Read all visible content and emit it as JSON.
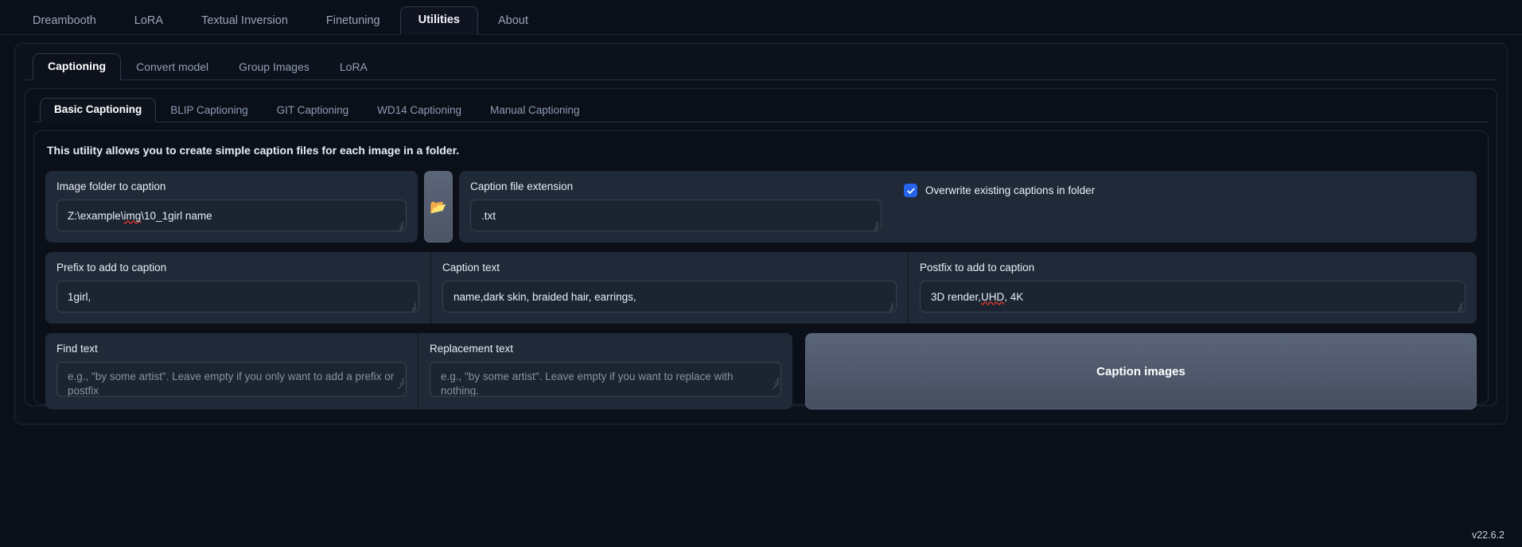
{
  "top_tabs": [
    {
      "label": "Dreambooth",
      "active": false
    },
    {
      "label": "LoRA",
      "active": false
    },
    {
      "label": "Textual Inversion",
      "active": false
    },
    {
      "label": "Finetuning",
      "active": false
    },
    {
      "label": "Utilities",
      "active": true
    },
    {
      "label": "About",
      "active": false
    }
  ],
  "second_tabs": [
    {
      "label": "Captioning",
      "active": true
    },
    {
      "label": "Convert model",
      "active": false
    },
    {
      "label": "Group Images",
      "active": false
    },
    {
      "label": "LoRA",
      "active": false
    }
  ],
  "third_tabs": [
    {
      "label": "Basic Captioning",
      "active": true
    },
    {
      "label": "BLIP Captioning",
      "active": false
    },
    {
      "label": "GIT Captioning",
      "active": false
    },
    {
      "label": "WD14 Captioning",
      "active": false
    },
    {
      "label": "Manual Captioning",
      "active": false
    }
  ],
  "description": "This utility allows you to create simple caption files for each image in a folder.",
  "fields": {
    "image_folder": {
      "label": "Image folder to caption",
      "value_prefix": "Z:\\example\\",
      "value_spell": "img",
      "value_suffix": "\\10_1girl name"
    },
    "folder_button": {
      "icon": "folder-open-icon",
      "glyph": "📂"
    },
    "caption_extension": {
      "label": "Caption file extension",
      "value": ".txt"
    },
    "overwrite": {
      "label": "Overwrite existing captions in folder",
      "checked": true,
      "color": "#2563eb"
    },
    "prefix": {
      "label": "Prefix to add to caption",
      "value": "1girl,"
    },
    "caption_text": {
      "label": "Caption text",
      "value": "name,dark skin, braided hair, earrings,"
    },
    "postfix": {
      "label": "Postfix to add to caption",
      "value_prefix": "3D render, ",
      "value_spell": "UHD",
      "value_suffix": ", 4K"
    },
    "find_text": {
      "label": "Find text",
      "value": "",
      "placeholder": "e.g., \"by some artist\". Leave empty if you only want to add a prefix or postfix"
    },
    "replacement_text": {
      "label": "Replacement text",
      "value": "",
      "placeholder": "e.g., \"by some artist\". Leave empty if you want to replace with nothing."
    }
  },
  "caption_button": {
    "label": "Caption images"
  },
  "version": "v22.6.2"
}
